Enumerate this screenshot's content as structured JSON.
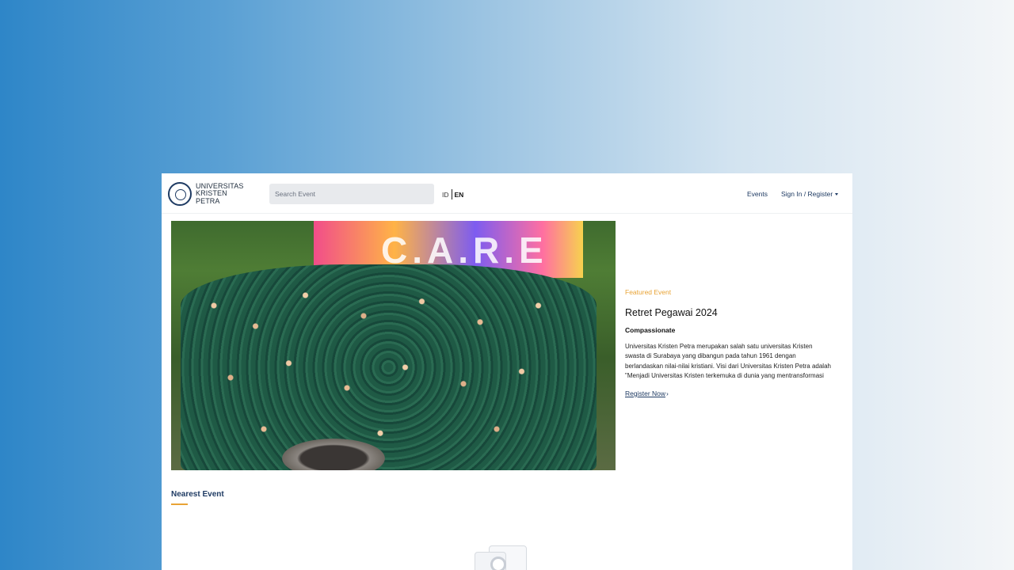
{
  "header": {
    "logo_lines": [
      "UNIVERSITAS",
      "KRISTEN",
      "PETRA"
    ],
    "search_placeholder": "Search Event",
    "lang_id": "ID",
    "lang_en": "EN",
    "nav_events": "Events",
    "nav_sign_in": "Sign In / Register"
  },
  "hero": {
    "banner_text": "C.A.R.E"
  },
  "featured": {
    "tag": "Featured Event",
    "title": "Retret Pegawai 2024",
    "subtitle": "Compassionate",
    "description": "Universitas Kristen Petra merupakan salah satu universitas Kristen swasta di Surabaya yang dibangun pada tahun 1961 dengan berlandaskan nilai-nilai kristiani. Visi dari Universitas Kristen Petra adalah \"Menjadi Universitas Kristen terkemuka di dunia yang mentransformasi masyarakat untuk Kemuliaan Tuhan\". Universitas",
    "cta": "Register Now"
  },
  "nearest": {
    "label": "Nearest Event"
  },
  "colors": {
    "accent": "#e8a335",
    "primary": "#1f3b63"
  }
}
